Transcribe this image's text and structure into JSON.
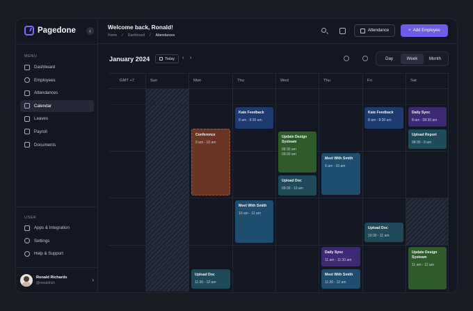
{
  "brand": {
    "name": "Pagedone"
  },
  "sidebar": {
    "menu_label": "MENU",
    "items": [
      {
        "label": "Dashboard",
        "icon": "home-icon"
      },
      {
        "label": "Employees",
        "icon": "user-icon"
      },
      {
        "label": "Attendances",
        "icon": "checkbox-icon"
      },
      {
        "label": "Calendar",
        "icon": "calendar-icon",
        "active": true
      },
      {
        "label": "Leaves",
        "icon": "leave-icon"
      },
      {
        "label": "Payroll",
        "icon": "payroll-icon"
      },
      {
        "label": "Documents",
        "icon": "folder-icon"
      }
    ],
    "user_label": "USER",
    "user_items": [
      {
        "label": "Apps & Integration",
        "icon": "grid-icon"
      },
      {
        "label": "Settings",
        "icon": "gear-icon"
      },
      {
        "label": "Help & Support",
        "icon": "help-icon"
      }
    ],
    "profile": {
      "name": "Ronald Richards",
      "handle": "@ronaldrich"
    }
  },
  "header": {
    "welcome": "Welcome back, Ronald!",
    "breadcrumb": [
      "Home",
      "Dashboard",
      "Attendances"
    ],
    "attendance_button": "Attendance",
    "add_employee_button": "Add Employee"
  },
  "calendar": {
    "month": "January 2024",
    "today_button": "Today",
    "views": [
      "Day",
      "Week",
      "Month"
    ],
    "active_view": "Week",
    "timezone": "GMT +7",
    "days": [
      "Sun",
      "Mon",
      "Thu",
      "Wed",
      "Thu",
      "Fri",
      "Sat"
    ],
    "events": [
      {
        "title": "Kate Feedback",
        "time": "8 am - 8:30 am",
        "color": "#1f3a6e"
      },
      {
        "title": "Conference",
        "time": "9 am - 10 am",
        "color": "#6b3524"
      },
      {
        "title": "Update Design Systeam",
        "time": "08:30 am\n09:30 am",
        "color": "#2f5a2a"
      },
      {
        "title": "Upload Doc",
        "time": "09:30 - 10 am",
        "color": "#1f4a5a"
      },
      {
        "title": "Meet With Smith",
        "time": "9 am - 10 am",
        "color": "#1e4d6e"
      },
      {
        "title": "Kate Feedback",
        "time": "8 am - 8:30 am",
        "color": "#1f3a6e"
      },
      {
        "title": "Daily Sync",
        "time": "8 am - 08:30 am",
        "color": "#3e2a74"
      },
      {
        "title": "Upload Report",
        "time": "08:30 - 9 am",
        "color": "#1f4a5a"
      },
      {
        "title": "Meet With Smith",
        "time": "10 am - 11 am",
        "color": "#1e4d6e"
      },
      {
        "title": "Upload Doc",
        "time": "10:30 - 11 am",
        "color": "#1f4a5a"
      },
      {
        "title": "Daily Sync",
        "time": "11 am - 11:30 am",
        "color": "#3e2a74"
      },
      {
        "title": "Meet With Smith",
        "time": "11:30 - 12 am",
        "color": "#1e4d6e"
      },
      {
        "title": "Update Design Systeam",
        "time": "11 am - 12 am",
        "color": "#2f5a2a"
      },
      {
        "title": "Upload Doc",
        "time": "11:30 - 12 am",
        "color": "#1f4a5a"
      }
    ]
  }
}
